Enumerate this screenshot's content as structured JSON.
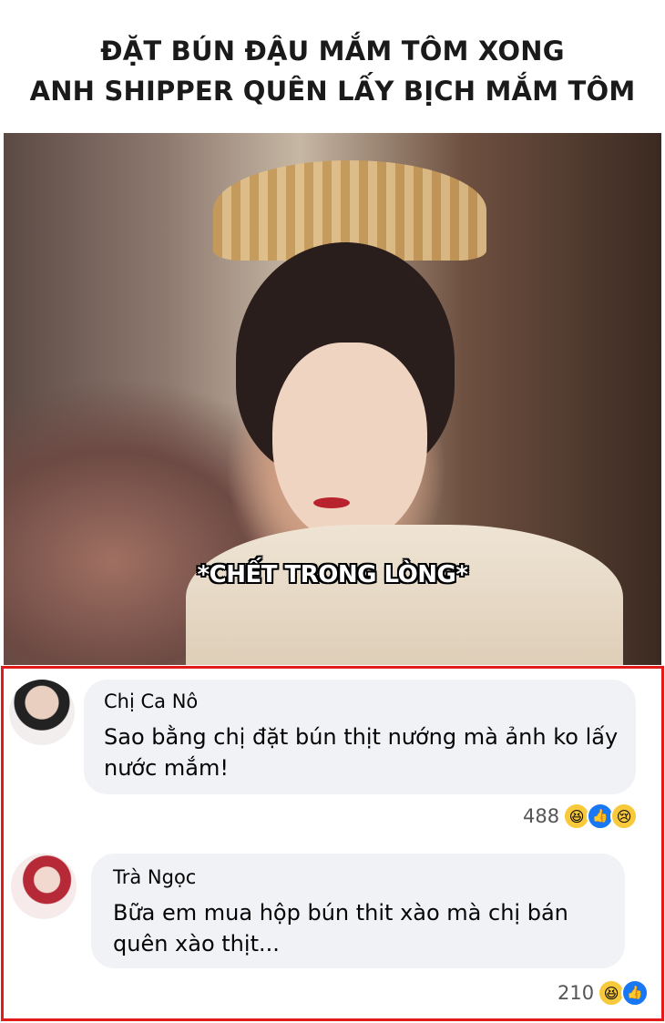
{
  "title": {
    "line1": "ĐẶT BÚN ĐẬU MẮM TÔM XONG",
    "line2": "ANH SHIPPER QUÊN LẤY BỊCH MẮM TÔM"
  },
  "caption": "*CHẾT TRONG LÒNG*",
  "comments": [
    {
      "name": "Chị Ca Nô",
      "text": "Sao bằng chị đặt bún thịt nướng mà ảnh ko lấy nước mắm!",
      "reaction_count": "488",
      "reactions": [
        "haha-icon",
        "like-icon",
        "sad-icon"
      ]
    },
    {
      "name": "Trà Ngọc",
      "text": "Bữa em mua hộp bún thit xào mà chị bán quên xào thịt...",
      "reaction_count": "210",
      "reactions": [
        "haha-icon",
        "like-icon"
      ]
    }
  ],
  "colors": {
    "highlight_border": "#e21a1a",
    "bubble_bg": "#f0f2f5",
    "like_blue": "#1877f2"
  }
}
